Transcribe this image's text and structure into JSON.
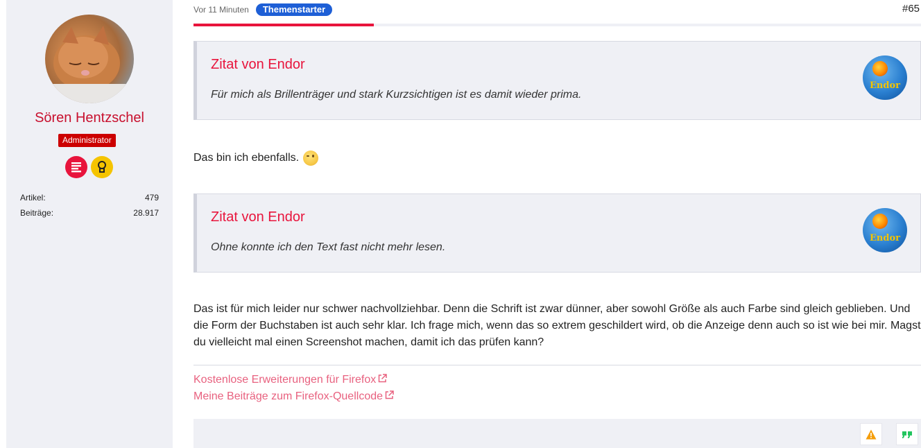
{
  "author": {
    "name": "Sören Hentzschel",
    "role": "Administrator",
    "stats": [
      {
        "label": "Artikel",
        "value": "479"
      },
      {
        "label": "Beiträge",
        "value": "28.917"
      }
    ]
  },
  "post": {
    "time": "Vor 11 Minuten",
    "badge": "Themenstarter",
    "number": "#65",
    "read_progress": 0.248,
    "quotes": [
      {
        "title": "Zitat von Endor",
        "text": "Für mich als Brillenträger und stark Kurzsichtigen ist es damit wieder prima.",
        "avatar_label": "Endor"
      },
      {
        "title": "Zitat von Endor",
        "text": "Ohne konnte ich den Text fast nicht mehr lesen.",
        "avatar_label": "Endor"
      }
    ],
    "reply1": "Das bin ich ebenfalls.",
    "reply2": "Das ist für mich leider nur schwer nachvollziehbar. Denn die Schrift ist zwar dünner, aber sowohl Größe als auch Farbe sind gleich geblieben. Und die Form der Buchstaben ist auch sehr klar. Ich frage mich, wenn das so extrem geschildert wird, ob die Anzeige denn auch so ist wie bei mir. Magst du vielleicht mal einen Screenshot machen, damit ich das prüfen kann?",
    "signature": [
      "Kostenlose Erweiterungen für Firefox",
      "Meine Beiträge zum Firefox-Quellcode"
    ]
  },
  "colors": {
    "accent": "#e8143c",
    "badge_blue": "#1e5fd6",
    "admin_red": "#cc0000",
    "link_pink": "#e8617f"
  },
  "icons": [
    "wink-emoji-icon",
    "external-link-icon",
    "warning-icon",
    "quote-icon",
    "articles-award-icon",
    "lightbulb-award-icon"
  ]
}
